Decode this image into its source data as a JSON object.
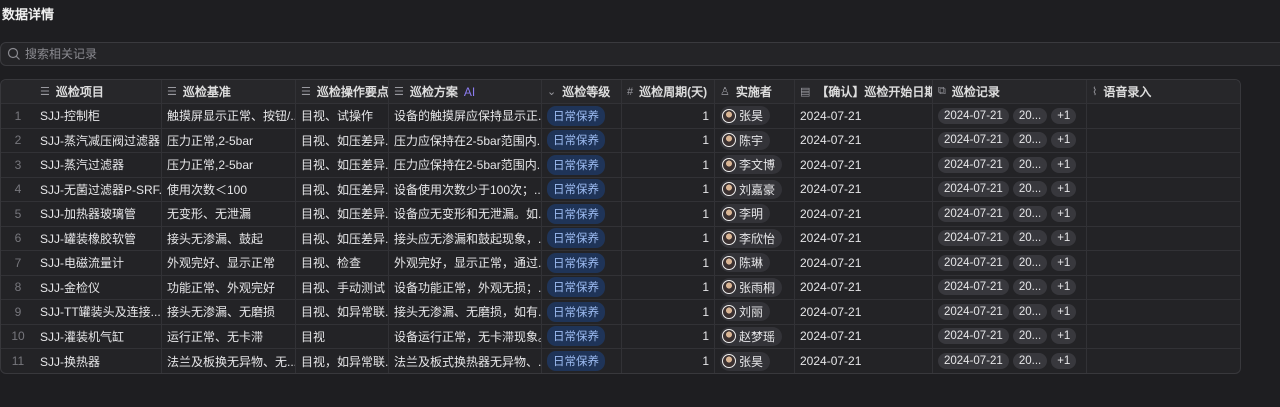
{
  "title": "数据详情",
  "search": {
    "placeholder": "搜索相关记录"
  },
  "headers": [
    {
      "label": "巡检项目",
      "icon": "text-icon"
    },
    {
      "label": "巡检基准",
      "icon": "text-icon"
    },
    {
      "label": "巡检操作要点",
      "icon": "text-icon"
    },
    {
      "label": "巡检方案",
      "icon": "text-icon",
      "ai": "AI"
    },
    {
      "label": "巡检等级",
      "icon": "single-select-icon"
    },
    {
      "label": "巡检周期(天)",
      "icon": "number-icon"
    },
    {
      "label": "实施者",
      "icon": "person-icon"
    },
    {
      "label": "【确认】巡检开始日期",
      "icon": "calendar-icon"
    },
    {
      "label": "巡检记录",
      "icon": "lookup-icon"
    },
    {
      "label": "语音录入",
      "icon": "attachment-icon"
    }
  ],
  "rows": [
    {
      "n": "1",
      "item": "SJJ-控制柜",
      "std": "触摸屏显示正常、按钮/...",
      "op": "目视、试操作",
      "plan": "设备的触摸屏应保持显示正...",
      "level": "日常保养",
      "cycle": "1",
      "person": "张昊",
      "date": "2024-07-21",
      "rec": [
        "2024-07-21",
        "20...",
        "+1"
      ]
    },
    {
      "n": "2",
      "item": "SJJ-蒸汽减压阀过滤器",
      "std": "压力正常,2-5bar",
      "op": "目视、如压差异...",
      "plan": "压力应保持在2-5bar范围内...",
      "level": "日常保养",
      "cycle": "1",
      "person": "陈宇",
      "date": "2024-07-21",
      "rec": [
        "2024-07-21",
        "20...",
        "+1"
      ]
    },
    {
      "n": "3",
      "item": "SJJ-蒸汽过滤器",
      "std": "压力正常,2-5bar",
      "op": "目视、如压差异...",
      "plan": "压力应保持在2-5bar范围内...",
      "level": "日常保养",
      "cycle": "1",
      "person": "李文博",
      "date": "2024-07-21",
      "rec": [
        "2024-07-21",
        "20...",
        "+1"
      ]
    },
    {
      "n": "4",
      "item": "SJJ-无菌过滤器P-SRF...",
      "std": "使用次数＜100",
      "op": "目视、如压差异...",
      "plan": "设备使用次数少于100次；...",
      "level": "日常保养",
      "cycle": "1",
      "person": "刘嘉豪",
      "date": "2024-07-21",
      "rec": [
        "2024-07-21",
        "20...",
        "+1"
      ]
    },
    {
      "n": "5",
      "item": "SJJ-加热器玻璃管",
      "std": "无变形、无泄漏",
      "op": "目视、如压差异...",
      "plan": "设备应无变形和无泄漏。如...",
      "level": "日常保养",
      "cycle": "1",
      "person": "李明",
      "date": "2024-07-21",
      "rec": [
        "2024-07-21",
        "20...",
        "+1"
      ]
    },
    {
      "n": "6",
      "item": "SJJ-罐装橡胶软管",
      "std": "接头无渗漏、鼓起",
      "op": "目视、如压差异...",
      "plan": "接头应无渗漏和鼓起现象，...",
      "level": "日常保养",
      "cycle": "1",
      "person": "李欣怡",
      "date": "2024-07-21",
      "rec": [
        "2024-07-21",
        "20...",
        "+1"
      ]
    },
    {
      "n": "7",
      "item": "SJJ-电磁流量计",
      "std": "外观完好、显示正常",
      "op": "目视、检查",
      "plan": "外观完好，显示正常，通过...",
      "level": "日常保养",
      "cycle": "1",
      "person": "陈琳",
      "date": "2024-07-21",
      "rec": [
        "2024-07-21",
        "20...",
        "+1"
      ]
    },
    {
      "n": "8",
      "item": "SJJ-金检仪",
      "std": "功能正常、外观完好",
      "op": "目视、手动测试",
      "plan": "设备功能正常，外观无损；...",
      "level": "日常保养",
      "cycle": "1",
      "person": "张雨桐",
      "date": "2024-07-21",
      "rec": [
        "2024-07-21",
        "20...",
        "+1"
      ]
    },
    {
      "n": "9",
      "item": "SJJ-TT罐装头及连接...",
      "std": "接头无渗漏、无磨损",
      "op": "目视、如异常联...",
      "plan": "接头无渗漏、无磨损，如有...",
      "level": "日常保养",
      "cycle": "1",
      "person": "刘丽",
      "date": "2024-07-21",
      "rec": [
        "2024-07-21",
        "20...",
        "+1"
      ]
    },
    {
      "n": "10",
      "item": "SJJ-灌装机气缸",
      "std": "运行正常、无卡滞",
      "op": "目视",
      "plan": "设备运行正常，无卡滞现象。",
      "level": "日常保养",
      "cycle": "1",
      "person": "赵梦瑶",
      "date": "2024-07-21",
      "rec": [
        "2024-07-21",
        "20...",
        "+1"
      ]
    },
    {
      "n": "11",
      "item": "SJJ-换热器",
      "std": "法兰及板换无异物、无...",
      "op": "目视，如异常联...",
      "plan": "法兰及板式换热器无异物、...",
      "level": "日常保养",
      "cycle": "1",
      "person": "张昊",
      "date": "2024-07-21",
      "rec": [
        "2024-07-21",
        "20...",
        "+1"
      ]
    }
  ]
}
